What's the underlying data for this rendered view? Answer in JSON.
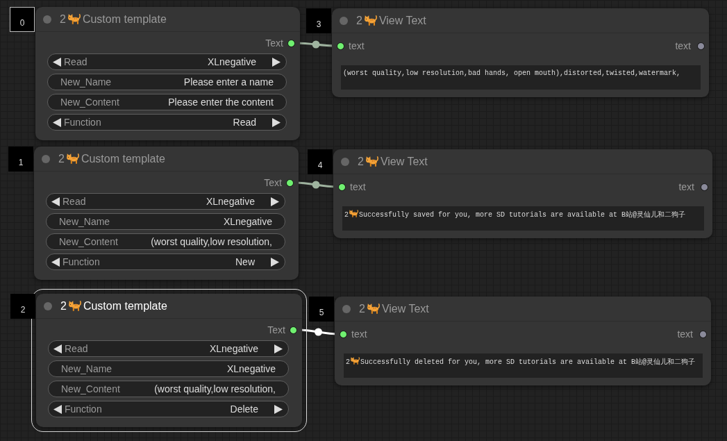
{
  "pairs": [
    {
      "template": {
        "badge": "0",
        "badge_outlined": true,
        "selected": false,
        "title": {
          "prefix": "2",
          "label": "Custom template"
        },
        "output": {
          "label": "Text",
          "connected": true
        },
        "widgets": [
          {
            "kind": "combo",
            "label": "Read",
            "value": "XLnegative"
          },
          {
            "kind": "text",
            "label": "New_Name",
            "value": "Please enter a name"
          },
          {
            "kind": "text",
            "label": "New_Content",
            "value": "Please enter the content"
          },
          {
            "kind": "combo",
            "label": "Function",
            "value": "Read"
          }
        ]
      },
      "viewer": {
        "badge": "3",
        "badge_outlined": false,
        "selected": false,
        "title": {
          "prefix": "2",
          "label": "View Text"
        },
        "input": {
          "label": "text",
          "connected": true
        },
        "output": {
          "label": "text",
          "connected": false
        },
        "text": {
          "body": "(worst quality,low resolution,bad hands, open mouth),distorted,twisted,watermark,"
        }
      }
    },
    {
      "template": {
        "badge": "1",
        "badge_outlined": false,
        "selected": false,
        "title": {
          "prefix": "2",
          "label": "Custom template"
        },
        "output": {
          "label": "Text",
          "connected": true
        },
        "widgets": [
          {
            "kind": "combo",
            "label": "Read",
            "value": "XLnegative"
          },
          {
            "kind": "text",
            "label": "New_Name",
            "value": "XLnegative"
          },
          {
            "kind": "text",
            "label": "New_Content",
            "value": "(worst quality,low resolution,"
          },
          {
            "kind": "combo",
            "label": "Function",
            "value": "New"
          }
        ]
      },
      "viewer": {
        "badge": "4",
        "badge_outlined": false,
        "selected": false,
        "title": {
          "prefix": "2",
          "label": "View Text"
        },
        "input": {
          "label": "text",
          "connected": true
        },
        "output": {
          "label": "text",
          "connected": false
        },
        "text": {
          "prefix": "2",
          "body": "Successfully saved for you, more SD tutorials are available at B站@灵仙儿和二狗子"
        }
      }
    },
    {
      "template": {
        "badge": "2",
        "badge_outlined": false,
        "selected": true,
        "title": {
          "prefix": "2",
          "label": "Custom template"
        },
        "output": {
          "label": "Text",
          "connected": true
        },
        "widgets": [
          {
            "kind": "combo",
            "label": "Read",
            "value": "XLnegative"
          },
          {
            "kind": "text",
            "label": "New_Name",
            "value": "XLnegative"
          },
          {
            "kind": "text",
            "label": "New_Content",
            "value": "(worst quality,low resolution,"
          },
          {
            "kind": "combo",
            "label": "Function",
            "value": "Delete"
          }
        ]
      },
      "viewer": {
        "badge": "5",
        "badge_outlined": false,
        "selected": false,
        "title": {
          "prefix": "2",
          "label": "View Text"
        },
        "input": {
          "label": "text",
          "connected": true
        },
        "output": {
          "label": "text",
          "connected": false
        },
        "text": {
          "prefix": "2",
          "body": "Successfully deleted for you, more SD tutorials are available at B站@灵仙儿和二狗子"
        }
      }
    }
  ]
}
